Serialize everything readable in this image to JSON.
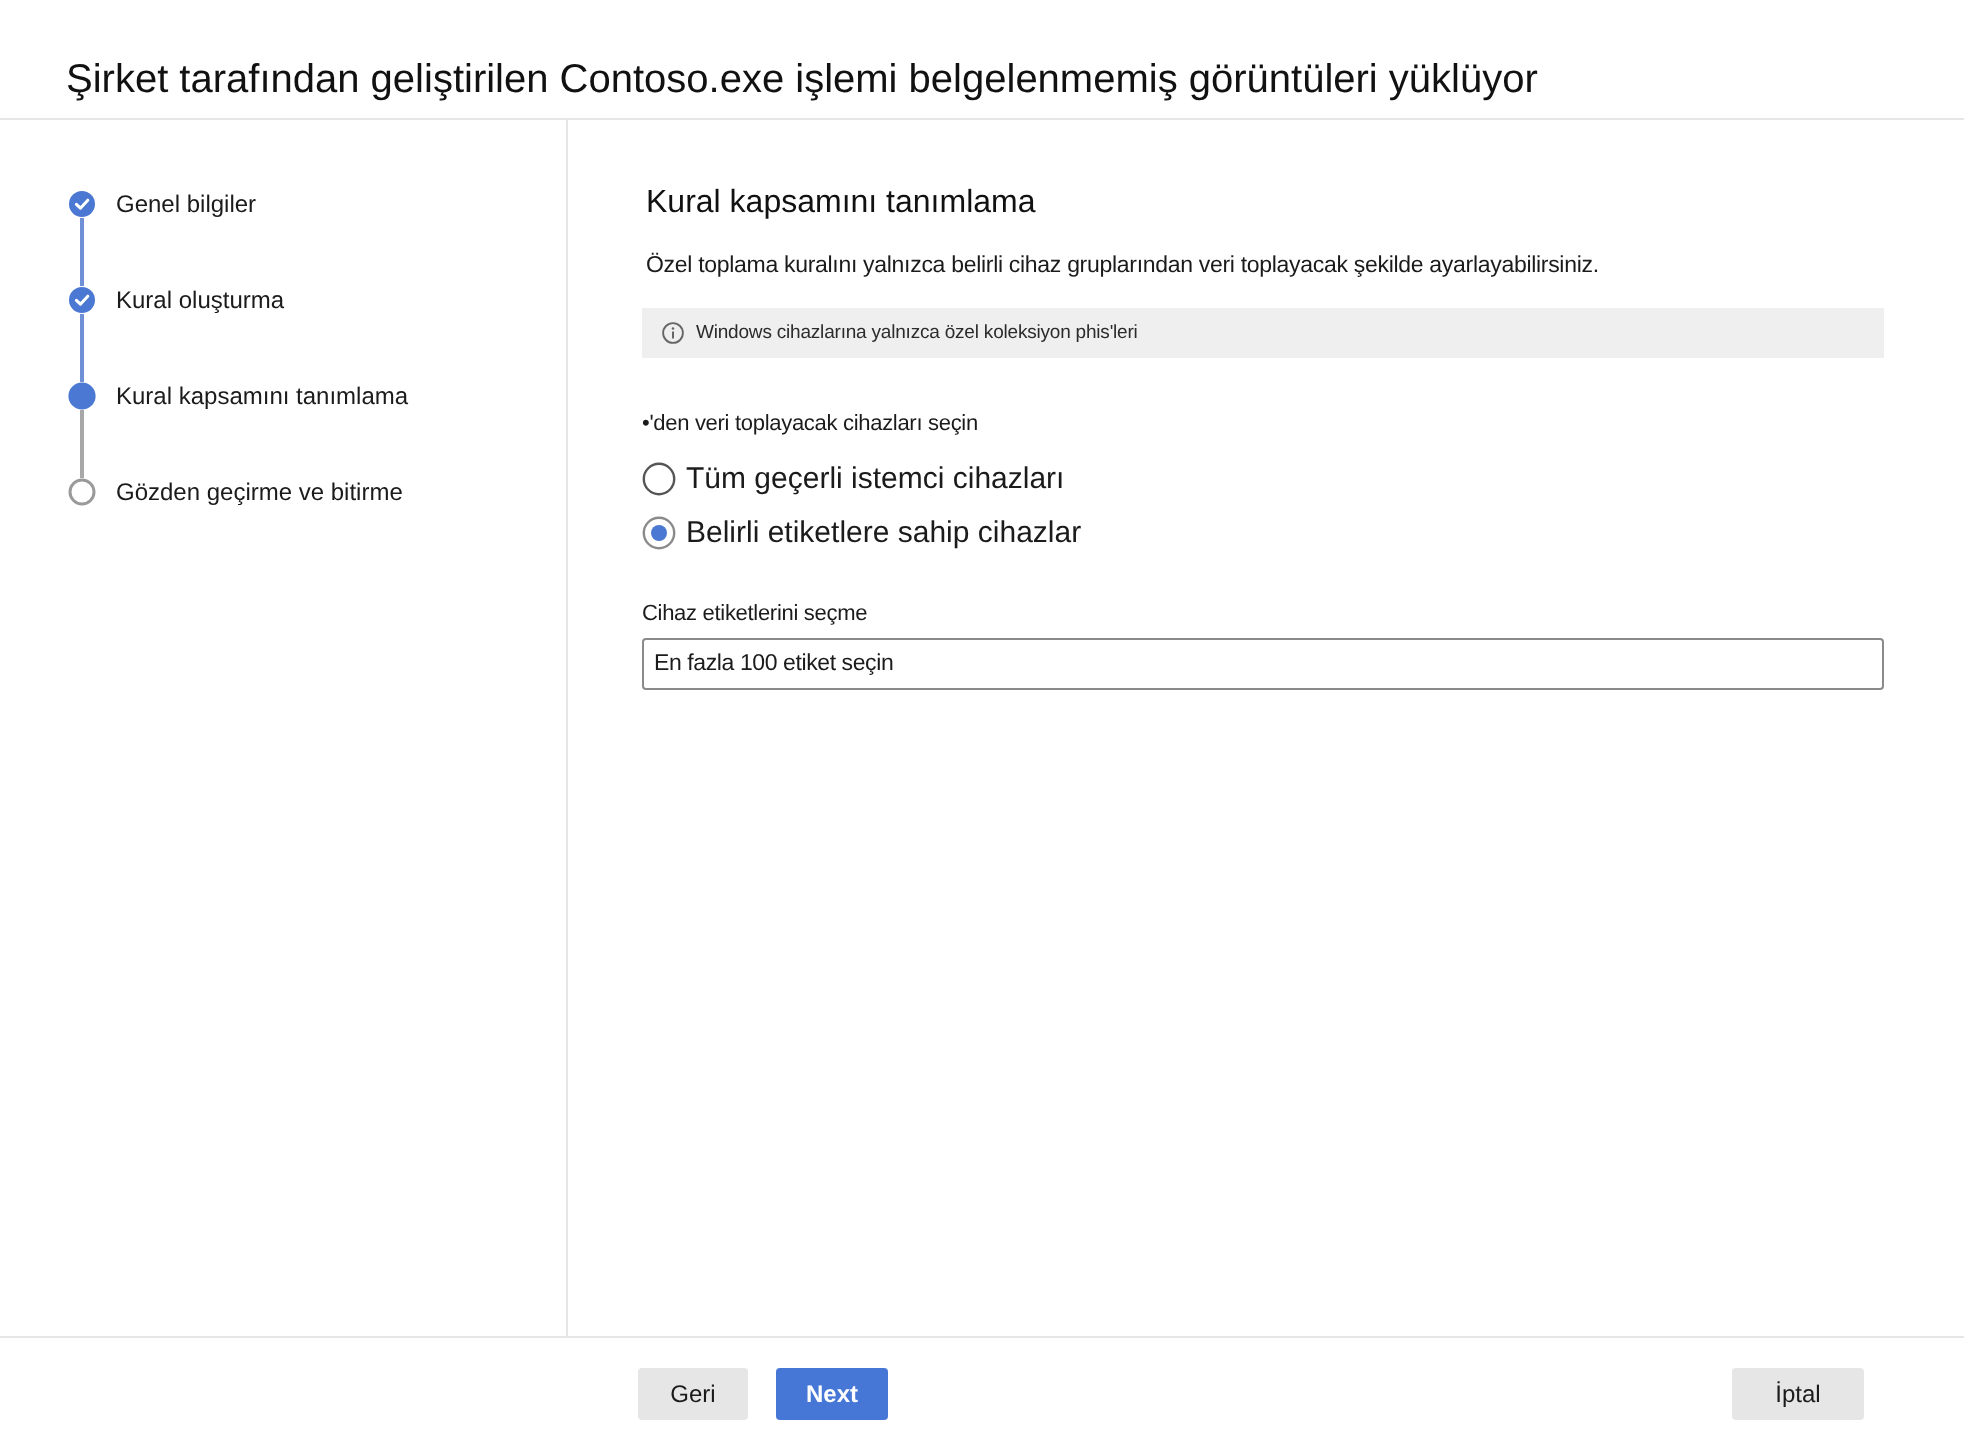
{
  "window": {
    "title": "Şirket tarafından geliştirilen Contoso.exe işlemi belgelenmemiş görüntüleri yüklüyor"
  },
  "steps": [
    {
      "label": "Genel bilgiler",
      "kind": "completed"
    },
    {
      "label": "Kural oluşturma",
      "kind": "completed"
    },
    {
      "label": "Kural kapsamını tanımlama",
      "kind": "current"
    },
    {
      "label": "Gözden geçirme ve bitirme",
      "kind": "pending"
    }
  ],
  "section": {
    "heading": "Kural kapsamını tanımlama",
    "description": "Özel toplama kuralını yalnızca belirli cihaz gruplarından veri toplayacak şekilde ayarlayabilirsiniz.",
    "info": "Windows cihazlarına yalnızca özel koleksiyon phis'leri",
    "scope_prompt": "•'den veri toplayacak cihazları seçin",
    "options": [
      {
        "label": "Tüm geçerli istemci cihazları",
        "selected": false
      },
      {
        "label": "Belirli etiketlere sahip cihazlar",
        "selected": true
      }
    ],
    "tags_field": {
      "label": "Cihaz etiketlerini seçme",
      "placeholder": "En fazla 100 etiket seçin"
    }
  },
  "buttons": [
    {
      "label": "Geri",
      "kind": "secondary"
    },
    {
      "label": "Next",
      "kind": "primary"
    },
    {
      "label": "İptal",
      "kind": "cancel"
    }
  ]
}
